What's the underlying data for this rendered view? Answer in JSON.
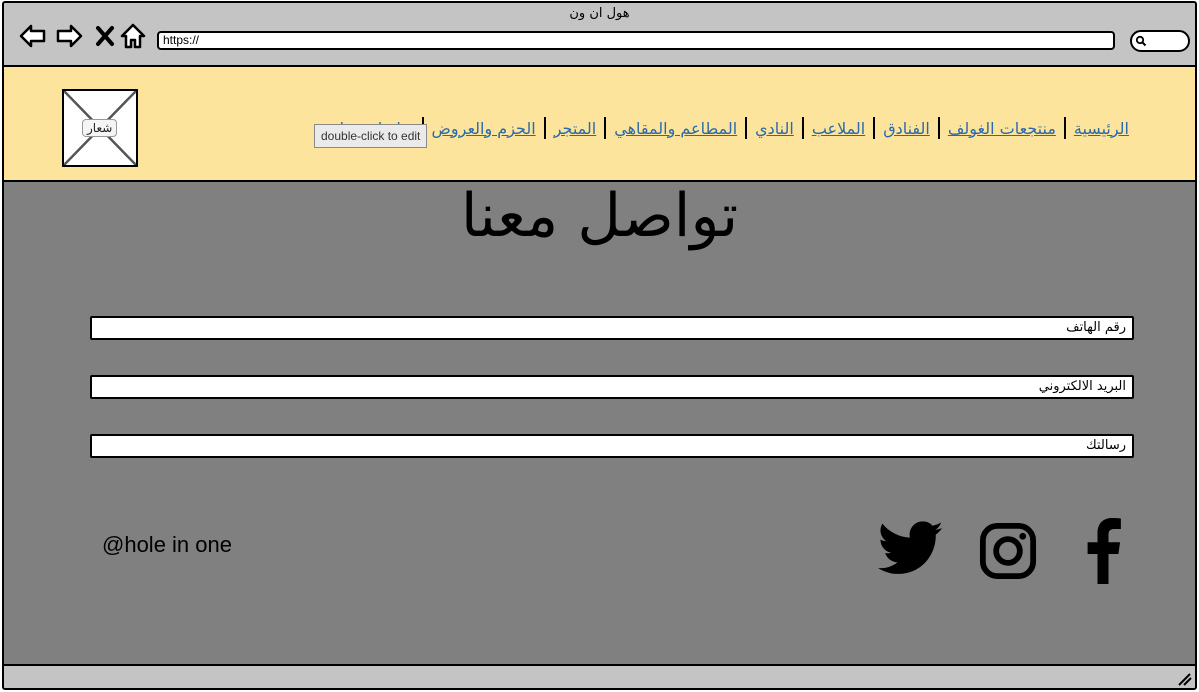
{
  "window": {
    "title": "هول ان ون"
  },
  "browser": {
    "url": "https://"
  },
  "header": {
    "logo_label": "شعار",
    "nav": [
      "الرئيسية",
      "منتجعات الغولف",
      "الفنادق",
      "الملاعب",
      "النادي",
      "المطاعم والمقاهي",
      "المتجر",
      "الحزم والعروض",
      "تواصل معنا"
    ],
    "tooltip": "double-click to edit"
  },
  "main": {
    "title": "تواصل معنا",
    "fields": {
      "phone_placeholder": "رقم الهاتف",
      "email_placeholder": "البريد الالكتروني",
      "message_placeholder": "رسالتك"
    },
    "handle": "@hole in one",
    "social_icons": [
      "facebook-icon",
      "instagram-icon",
      "twitter-icon"
    ]
  },
  "colors": {
    "header_bg": "#fde49d",
    "body_bg": "#808080",
    "chrome_bg": "#c4c4c4",
    "link": "#2a6aa8"
  }
}
